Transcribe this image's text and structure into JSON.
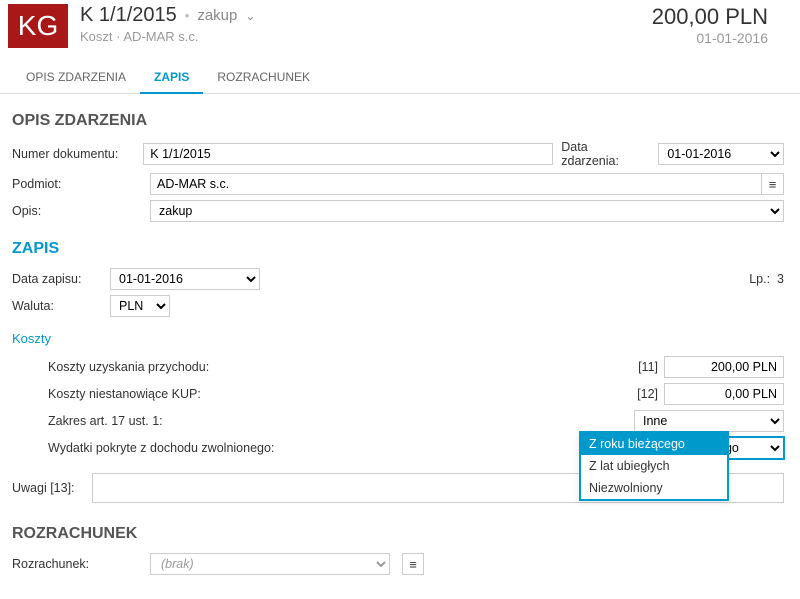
{
  "header": {
    "badge": "KG",
    "title": "K 1/1/2015",
    "type": "zakup",
    "subtitle_kind": "Koszt",
    "subtitle_vendor": "AD-MAR s.c.",
    "amount": "200,00 PLN",
    "date": "01-01-2016"
  },
  "tabs": [
    "OPIS ZDARZENIA",
    "ZAPIS",
    "ROZRACHUNEK"
  ],
  "active_tab": 1,
  "opis": {
    "header": "OPIS ZDARZENIA",
    "numer_label": "Numer dokumentu:",
    "numer_value": "K 1/1/2015",
    "data_label": "Data zdarzenia:",
    "data_value": "01-01-2016",
    "podmiot_label": "Podmiot:",
    "podmiot_value": "AD-MAR s.c.",
    "opis_label": "Opis:",
    "opis_value": "zakup"
  },
  "zapis": {
    "header": "ZAPIS",
    "data_label": "Data zapisu:",
    "data_value": "01-01-2016",
    "lp_label": "Lp.:",
    "lp_value": "3",
    "waluta_label": "Waluta:",
    "waluta_value": "PLN"
  },
  "koszty": {
    "header": "Koszty",
    "rows": [
      {
        "label": "Koszty uzyskania przychodu:",
        "code": "[11]",
        "value": "200,00 PLN"
      },
      {
        "label": "Koszty niestanowiące KUP:",
        "code": "[12]",
        "value": "0,00 PLN"
      }
    ],
    "zakres_label": "Zakres art. 17 ust. 1:",
    "zakres_value": "Inne",
    "wydatki_label": "Wydatki pokryte z dochodu zwolnionego:",
    "wydatki_value": "Z roku bieżącego",
    "wydatki_options": [
      "Z roku bieżącego",
      "Z lat ubiegłych",
      "Niezwolniony"
    ]
  },
  "uwagi": {
    "label": "Uwagi [13]:",
    "value": ""
  },
  "rozrachunek": {
    "header": "ROZRACHUNEK",
    "label": "Rozrachunek:",
    "value": "(brak)"
  }
}
